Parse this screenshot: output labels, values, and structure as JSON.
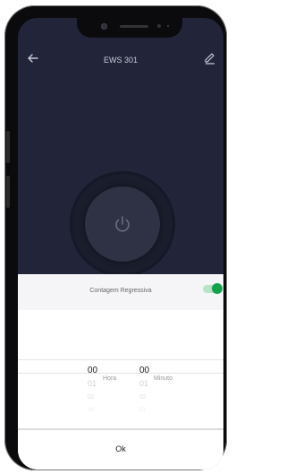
{
  "header": {
    "title": "EWS 301"
  },
  "countdown": {
    "label": "Contagem Regressiva",
    "enabled": true
  },
  "picker": {
    "hours": {
      "values": [
        "00",
        "01",
        "02",
        "03"
      ],
      "unit": "Hora"
    },
    "minutes": {
      "values": [
        "00",
        "01",
        "02",
        "03"
      ],
      "unit": "Minuto"
    }
  },
  "footer": {
    "ok_label": "Ok"
  },
  "colors": {
    "accent": "#13a34a",
    "background": "#22253a"
  }
}
